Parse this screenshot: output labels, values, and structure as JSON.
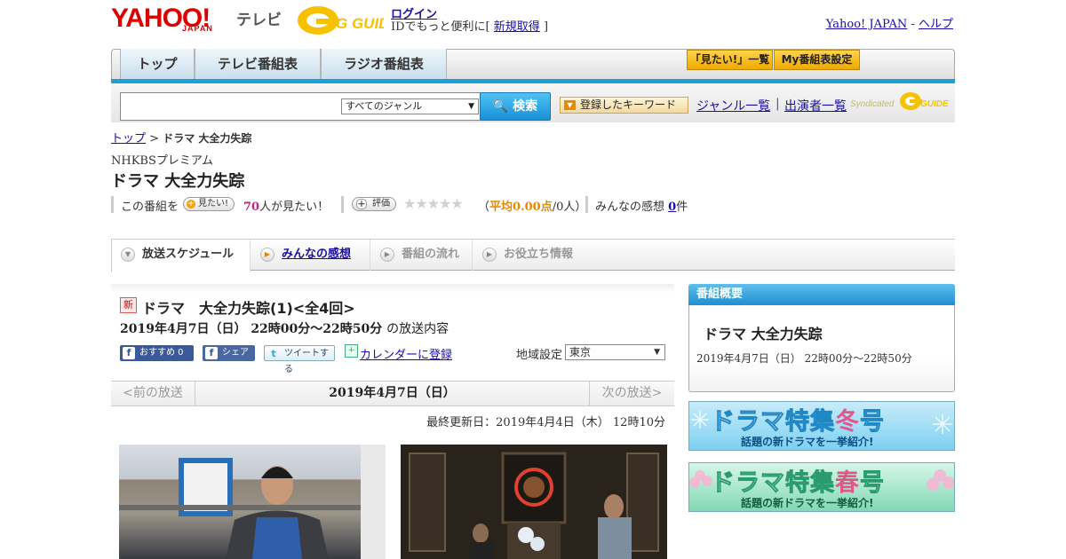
{
  "header": {
    "logo_yahoo": "YAHOO!",
    "logo_japan": "JAPAN",
    "logo_tv": "テレビ",
    "logo_gguide": "G GUIDE",
    "login": "ログイン",
    "login_sub_prefix": "IDでもっと便利に[",
    "signup": "新規取得",
    "login_sub_suffix": "]",
    "yahoo_japan": "Yahoo! JAPAN",
    "sep": " - ",
    "help": "ヘルプ"
  },
  "nav": {
    "tabs": [
      "トップ",
      "テレビ番組表",
      "ラジオ番組表"
    ],
    "wishlist": "「見たい!」一覧",
    "my_schedule": "My番組表設定"
  },
  "search": {
    "genre_selected": "すべてのジャンル",
    "button": "検索",
    "keyword_btn": "登録したキーワード",
    "genre_list": "ジャンル一覧",
    "separator": "|",
    "cast_list": "出演者一覧",
    "syndicated": "Syndicated"
  },
  "breadcrumb": {
    "top": "トップ",
    "sep": " > ",
    "current": "ドラマ 大全力失踪"
  },
  "program": {
    "channel": "NHKBSプレミアム",
    "title": "ドラマ 大全力失踪",
    "want_prefix": "この番組を",
    "want_btn": "見たい!",
    "want_count": "70",
    "want_suffix": "人が見たい！",
    "rate_btn": "評価",
    "stars": "★★★★★",
    "avg_open": "（",
    "avg_label": "平均",
    "avg_value": "0.00",
    "avg_unit": "点",
    "avg_count": "/0人）",
    "reviews_label": "みんなの感想",
    "reviews_count": "0",
    "reviews_unit": "件"
  },
  "subtabs": [
    "放送スケジュール",
    "みんなの感想",
    "番組の流れ",
    "お役立ち情報"
  ],
  "episode": {
    "badge": "新",
    "title": "ドラマ　大全力失踪(1)<全4回>",
    "datetime": "2019年4月7日（日） 22時00分～22時50分",
    "datetime_suffix": "の放送内容",
    "recommend": "おすすめ 0",
    "share": "シェア",
    "tweet": "ツイートする",
    "calendar": "カレンダーに登録",
    "region_label": "地域設定",
    "region_value": "東京"
  },
  "datenav": {
    "prev": "<前の放送",
    "current": "2019年4月7日（日）",
    "next": "次の放送>"
  },
  "updated": "最終更新日：2019年4月4日（木） 12時10分",
  "overview": {
    "heading": "番組概要",
    "title": "ドラマ 大全力失踪",
    "time": "2019年4月7日（日） 22時00分～22時50分"
  },
  "banners": {
    "winter_main_a": "ドラマ特集",
    "winter_season": "冬",
    "winter_main_b": "号",
    "winter_sub": "話題の新ドラマを一挙紹介!",
    "spring_main_a": "ドラマ特集",
    "spring_season": "春",
    "spring_main_b": "号",
    "spring_sub": "話題の新ドラマを一挙紹介!"
  }
}
